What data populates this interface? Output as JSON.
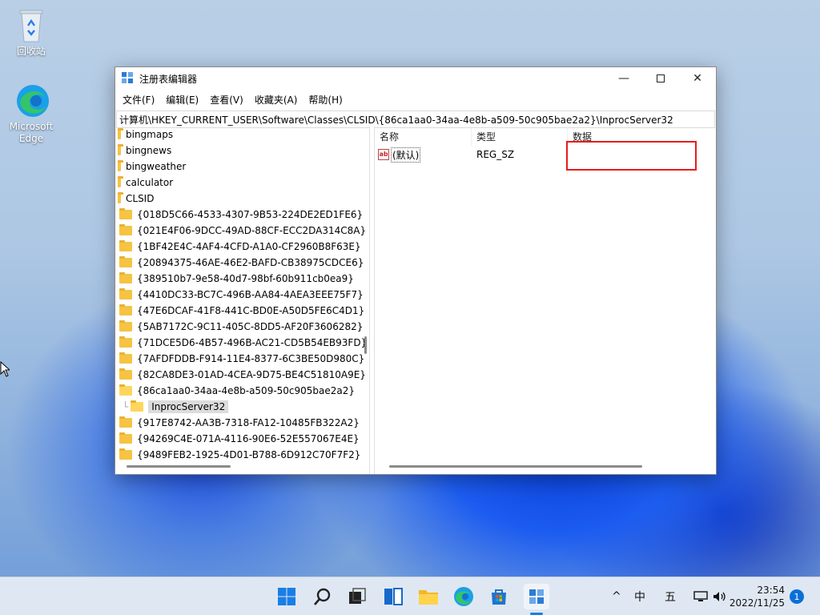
{
  "desktop": {
    "icons": [
      {
        "label": "回收站",
        "icon": "recycle-bin-icon"
      },
      {
        "label": "Microsoft Edge",
        "icon": "edge-icon"
      }
    ]
  },
  "window": {
    "title": "注册表编辑器",
    "menu": [
      "文件(F)",
      "编辑(E)",
      "查看(V)",
      "收藏夹(A)",
      "帮助(H)"
    ],
    "address": "计算机\\HKEY_CURRENT_USER\\Software\\Classes\\CLSID\\{86ca1aa0-34aa-4e8b-a509-50c905bae2a2}\\InprocServer32",
    "tree": [
      "bingmaps",
      "bingnews",
      "bingweather",
      "calculator",
      "CLSID",
      "{018D5C66-4533-4307-9B53-224DE2ED1FE6}",
      "{021E4F06-9DCC-49AD-88CF-ECC2DA314C8A}",
      "{1BF42E4C-4AF4-4CFD-A1A0-CF2960B8F63E}",
      "{20894375-46AE-46E2-BAFD-CB38975CDCE6}",
      "{389510b7-9e58-40d7-98bf-60b911cb0ea9}",
      "{4410DC33-BC7C-496B-AA84-4AEA3EEE75F7}",
      "{47E6DCAF-41F8-441C-BD0E-A50D5FE6C4D1}",
      "{5AB7172C-9C11-405C-8DD5-AF20F3606282}",
      "{71DCE5D6-4B57-496B-AC21-CD5B54EB93FD}",
      "{7AFDFDDB-F914-11E4-8377-6C3BE50D980C}",
      "{82CA8DE3-01AD-4CEA-9D75-BE4C51810A9E}",
      "{86ca1aa0-34aa-4e8b-a509-50c905bae2a2}",
      "InprocServer32",
      "{917E8742-AA3B-7318-FA12-10485FB322A2}",
      "{94269C4E-071A-4116-90E6-52E557067E4E}",
      "{9489FEB2-1925-4D01-B788-6D912C70F7F2}"
    ],
    "columns": {
      "name": "名称",
      "type": "类型",
      "data": "数据"
    },
    "values": [
      {
        "name": "(默认)",
        "type": "REG_SZ",
        "data": ""
      }
    ]
  },
  "taskbar": {
    "apps": [
      "start-icon",
      "search-icon",
      "task-view-icon",
      "widgets-icon",
      "file-explorer-icon",
      "edge-icon",
      "store-icon",
      "regedit-icon"
    ],
    "tray": {
      "chevron": "^",
      "ime": "中",
      "day": "五"
    },
    "time": "23:54",
    "date": "2022/11/25",
    "notifications": "1"
  }
}
